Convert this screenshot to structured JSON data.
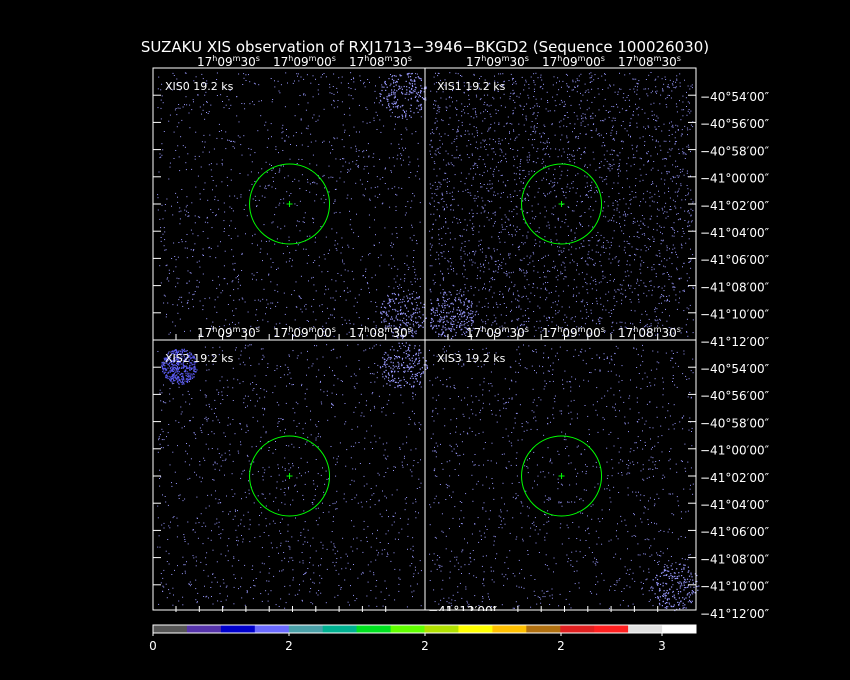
{
  "title": "SUZAKU XIS observation of RXJ1713−3946−BKGD2  (Sequence 100026030)",
  "ra_ticks": [
    {
      "h": "17",
      "m": "09",
      "s": "30"
    },
    {
      "h": "17",
      "m": "09",
      "s": "00"
    },
    {
      "h": "17",
      "m": "08",
      "s": "30"
    }
  ],
  "dec_ticks": [
    "−40°54′00″",
    "−40°56′00″",
    "−40°58′00″",
    "−41°00′00″",
    "−41°02′00″",
    "−41°04′00″",
    "−41°06′00″",
    "−41°08′00″",
    "−41°10′00″",
    "−41°12′00″"
  ],
  "panels": [
    {
      "label": "XIS0 19.2 ks",
      "bright_corners": [
        "top-right",
        "bottom-right"
      ]
    },
    {
      "label": "XIS1 19.2 ks",
      "bright_corners": [
        "bottom-left"
      ]
    },
    {
      "label": "XIS2 19.2 ks",
      "bright_corners": [
        "top-left",
        "top-right"
      ]
    },
    {
      "label": "XIS3 19.2 ks",
      "bright_corners": [
        "bottom-right"
      ]
    }
  ],
  "stray_label": "−41°12′00″",
  "colorbar": {
    "colors": [
      "#555555",
      "#5533aa",
      "#0000cc",
      "#6a6aff",
      "#4aa0a8",
      "#00b090",
      "#00e020",
      "#60ff00",
      "#b0e000",
      "#ffff00",
      "#ffc000",
      "#b07010",
      "#e02020",
      "#ff2020",
      "#e0e0e0",
      "#ffffff"
    ],
    "labels": [
      "0",
      "2",
      "2",
      "2",
      "3"
    ]
  },
  "colors": {
    "background": "#000000",
    "frame": "#ffffff",
    "region": "#00ff00",
    "events": "#9a9aff"
  }
}
